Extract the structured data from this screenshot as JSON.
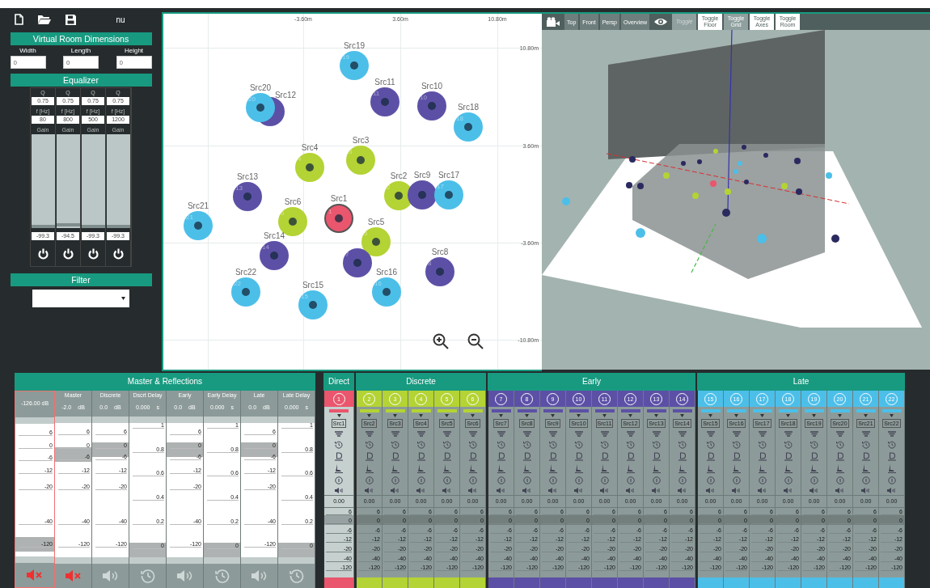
{
  "toolbar": {
    "label": "nu"
  },
  "room": {
    "title": "Virtual Room Dimensions",
    "fields": [
      {
        "label": "Width",
        "value": "0"
      },
      {
        "label": "Length",
        "value": "0"
      },
      {
        "label": "Height",
        "value": "0"
      }
    ]
  },
  "equalizer": {
    "title": "Equalizer",
    "bands": [
      {
        "q_label": "Q",
        "q": "0.75",
        "f_label": "f [Hz]",
        "f": "80",
        "gain_label": "Gain",
        "gain": "-99.3",
        "level": 0,
        "on": true
      },
      {
        "q_label": "Q",
        "q": "0.75",
        "f_label": "f [Hz]",
        "f": "800",
        "gain_label": "Gain",
        "gain": "-94.5",
        "level": 0.02,
        "on": true
      },
      {
        "q_label": "Q",
        "q": "0.75",
        "f_label": "f [Hz]",
        "f": "500",
        "gain_label": "Gain",
        "gain": "-99.3",
        "level": 0,
        "on": true
      },
      {
        "q_label": "Q",
        "q": "0.75",
        "f_label": "f [Hz]",
        "f": "1200",
        "gain_label": "Gain",
        "gain": "-99.3",
        "level": 0,
        "on": true
      }
    ]
  },
  "filter": {
    "title": "Filter"
  },
  "map": {
    "x_ticks": [
      "-3.60m",
      "3.60m",
      "10.80m"
    ],
    "y_ticks": [
      "10.80m",
      "3.60m",
      "-3.60m",
      "-10.80m"
    ],
    "sources": [
      {
        "label": "Src19",
        "number": "19",
        "color": "#4cbfe9",
        "selected": false
      },
      {
        "label": "Src20",
        "number": "20",
        "color": "#4cbfe9",
        "selected": false
      },
      {
        "label": "Src12",
        "color": "#5c50a6",
        "selected": false
      },
      {
        "label": "Src11",
        "number": "11",
        "color": "#5c50a6",
        "selected": false
      },
      {
        "label": "Src10",
        "number": "10",
        "color": "#5c50a6",
        "selected": false
      },
      {
        "label": "Src18",
        "number": "18",
        "color": "#4cbfe9",
        "selected": false
      },
      {
        "label": "Src4",
        "number": "4",
        "color": "#b4d334",
        "selected": false
      },
      {
        "label": "Src3",
        "number": "3",
        "color": "#b4d334",
        "selected": false
      },
      {
        "label": "Src13",
        "number": "13",
        "color": "#5c50a6",
        "selected": false
      },
      {
        "label": "Src2",
        "number": "2",
        "color": "#b4d334",
        "selected": false
      },
      {
        "label": "Src9",
        "color": "#5c50a6",
        "selected": false
      },
      {
        "label": "Src17",
        "number": "17",
        "color": "#4cbfe9",
        "selected": false
      },
      {
        "label": "Src21",
        "number": "21",
        "color": "#4cbfe9",
        "selected": false
      },
      {
        "label": "Src6",
        "number": "6",
        "color": "#b4d334",
        "selected": false
      },
      {
        "label": "Src1",
        "number": "1",
        "color": "#e9566d",
        "selected": true
      },
      {
        "label": "Src14",
        "number": "14",
        "color": "#5c50a6",
        "selected": false
      },
      {
        "label": "Src5",
        "number": "5",
        "color": "#b4d334",
        "selected": false
      },
      {
        "number": "7",
        "color": "#5c50a6",
        "selected": false
      },
      {
        "label": "Src8",
        "number": "8",
        "color": "#5c50a6",
        "selected": false
      },
      {
        "label": "Src22",
        "number": "22",
        "color": "#4cbfe9",
        "selected": false
      },
      {
        "label": "Src15",
        "number": "15",
        "color": "#4cbfe9",
        "selected": false
      },
      {
        "label": "Src16",
        "number": "16",
        "color": "#4cbfe9",
        "selected": false
      }
    ]
  },
  "view3d": {
    "views": [
      "Top",
      "Front",
      "Persp",
      "Overview"
    ],
    "toggles": [
      {
        "label": "Toggle",
        "on": false,
        "disabled": true
      },
      {
        "label": "Toggle Floor",
        "on": true,
        "disabled": false
      },
      {
        "label": "Toggle Grid",
        "on": false,
        "disabled": false
      },
      {
        "label": "Toggle Axes",
        "on": true,
        "disabled": false
      },
      {
        "label": "Toggle Room",
        "on": true,
        "disabled": false
      }
    ]
  },
  "master": {
    "title": "Master & Reflections",
    "meter": {
      "reading": "-126.00 dB",
      "level": 0.04,
      "muted": true,
      "scale": [
        "6",
        "0",
        "-6",
        "-12",
        "-20",
        "-40",
        "-120"
      ]
    },
    "strips": [
      {
        "label": "Master",
        "value": "-2.0",
        "unit": "dB",
        "kind": "gain",
        "level": 0.8,
        "muted": true,
        "scale": [
          "6",
          "0",
          "-6",
          "-12",
          "-20",
          "-40",
          "-120"
        ]
      },
      {
        "label": "Discrete",
        "value": "0.0",
        "unit": "dB",
        "kind": "gain",
        "level": 0.84,
        "muted": false,
        "scale": [
          "6",
          "0",
          "-6",
          "-12",
          "-20",
          "-40",
          "-120"
        ]
      },
      {
        "label": "Dscrt Delay",
        "value": "0.000",
        "unit": "s",
        "kind": "delay",
        "level": 0,
        "scale": [
          "1",
          "0.8",
          "0.6",
          "0.4",
          "0.2",
          "0"
        ]
      },
      {
        "label": "Early",
        "value": "0.0",
        "unit": "dB",
        "kind": "gain",
        "level": 0.84,
        "muted": false,
        "scale": [
          "6",
          "0",
          "-6",
          "-12",
          "-20",
          "-40",
          "-120"
        ]
      },
      {
        "label": "Early Delay",
        "value": "0.000",
        "unit": "s",
        "kind": "delay",
        "level": 0,
        "scale": [
          "1",
          "0.8",
          "0.6",
          "0.4",
          "0.2",
          "0"
        ]
      },
      {
        "label": "Late",
        "value": "0.0",
        "unit": "dB",
        "kind": "gain",
        "level": 0.84,
        "muted": false,
        "scale": [
          "6",
          "0",
          "-6",
          "-12",
          "-20",
          "-40",
          "-120"
        ]
      },
      {
        "label": "Late Delay",
        "value": "0.000",
        "unit": "s",
        "kind": "delay",
        "level": 0,
        "scale": [
          "1",
          "0.8",
          "0.6",
          "0.4",
          "0.2",
          "0"
        ]
      }
    ]
  },
  "groups": [
    {
      "title": "Direct",
      "color": "#e9566d",
      "channels": [
        {
          "number": "1",
          "source": "Src1",
          "value": "0.00",
          "selected": true,
          "level": 0.85,
          "scale": [
            "6",
            "0",
            "-6",
            "-12",
            "-20",
            "-40",
            "-120"
          ]
        }
      ]
    },
    {
      "title": "Discrete",
      "color": "#b4d334",
      "channels": [
        {
          "number": "2",
          "source": "Src2",
          "value": "0.00",
          "selected": false,
          "level": 0.85,
          "scale": [
            "6",
            "0",
            "-6",
            "-12",
            "-20",
            "-40",
            "-120"
          ]
        },
        {
          "number": "3",
          "source": "Src3",
          "value": "0.00",
          "selected": false,
          "level": 0.85,
          "scale": [
            "6",
            "0",
            "-6",
            "-12",
            "-20",
            "-40",
            "-120"
          ]
        },
        {
          "number": "4",
          "source": "Src4",
          "value": "0.00",
          "selected": false,
          "level": 0.85,
          "scale": [
            "6",
            "0",
            "-6",
            "-12",
            "-20",
            "-40",
            "-120"
          ]
        },
        {
          "number": "5",
          "source": "Src5",
          "value": "0.00",
          "selected": false,
          "level": 0.85,
          "scale": [
            "6",
            "0",
            "-6",
            "-12",
            "-20",
            "-40",
            "-120"
          ]
        },
        {
          "number": "6",
          "source": "Src6",
          "value": "0.00",
          "selected": false,
          "level": 0.85,
          "scale": [
            "6",
            "0",
            "-6",
            "-12",
            "-20",
            "-40",
            "-120"
          ]
        }
      ]
    },
    {
      "title": "Early",
      "color": "#5c50a6",
      "channels": [
        {
          "number": "7",
          "source": "Src7",
          "value": "0.00",
          "selected": false,
          "level": 0.85,
          "scale": [
            "6",
            "0",
            "-6",
            "-12",
            "-20",
            "-40",
            "-120"
          ]
        },
        {
          "number": "8",
          "source": "Src8",
          "value": "0.00",
          "selected": false,
          "level": 0.85,
          "scale": [
            "6",
            "0",
            "-6",
            "-12",
            "-20",
            "-40",
            "-120"
          ]
        },
        {
          "number": "9",
          "source": "Src9",
          "value": "0.00",
          "selected": false,
          "level": 0.85,
          "scale": [
            "6",
            "0",
            "-6",
            "-12",
            "-20",
            "-40",
            "-120"
          ]
        },
        {
          "number": "10",
          "source": "Src10",
          "value": "0.00",
          "selected": false,
          "level": 0.85,
          "scale": [
            "6",
            "0",
            "-6",
            "-12",
            "-20",
            "-40",
            "-120"
          ]
        },
        {
          "number": "11",
          "source": "Src11",
          "value": "0.00",
          "selected": false,
          "level": 0.85,
          "scale": [
            "6",
            "0",
            "-6",
            "-12",
            "-20",
            "-40",
            "-120"
          ]
        },
        {
          "number": "12",
          "source": "Src12",
          "value": "0.00",
          "selected": false,
          "level": 0.85,
          "scale": [
            "6",
            "0",
            "-6",
            "-12",
            "-20",
            "-40",
            "-120"
          ]
        },
        {
          "number": "13",
          "source": "Src13",
          "value": "0.00",
          "selected": false,
          "level": 0.85,
          "scale": [
            "6",
            "0",
            "-6",
            "-12",
            "-20",
            "-40",
            "-120"
          ]
        },
        {
          "number": "14",
          "source": "Src14",
          "value": "0.00",
          "selected": false,
          "level": 0.85,
          "scale": [
            "6",
            "0",
            "-6",
            "-12",
            "-20",
            "-40",
            "-120"
          ]
        }
      ]
    },
    {
      "title": "Late",
      "color": "#4cbfe9",
      "channels": [
        {
          "number": "15",
          "source": "Src15",
          "value": "0.00",
          "selected": false,
          "level": 0.85,
          "scale": [
            "6",
            "0",
            "-6",
            "-12",
            "-20",
            "-40",
            "-120"
          ]
        },
        {
          "number": "16",
          "source": "Src16",
          "value": "0.00",
          "selected": false,
          "level": 0.85,
          "scale": [
            "6",
            "0",
            "-6",
            "-12",
            "-20",
            "-40",
            "-120"
          ]
        },
        {
          "number": "17",
          "source": "Src17",
          "value": "0.00",
          "selected": false,
          "level": 0.85,
          "scale": [
            "6",
            "0",
            "-6",
            "-12",
            "-20",
            "-40",
            "-120"
          ]
        },
        {
          "number": "18",
          "source": "Src18",
          "value": "0.00",
          "selected": false,
          "level": 0.85,
          "scale": [
            "6",
            "0",
            "-6",
            "-12",
            "-20",
            "-40",
            "-120"
          ]
        },
        {
          "number": "19",
          "source": "Src19",
          "value": "0.00",
          "selected": false,
          "level": 0.85,
          "scale": [
            "6",
            "0",
            "-6",
            "-12",
            "-20",
            "-40",
            "-120"
          ]
        },
        {
          "number": "20",
          "source": "Src20",
          "value": "0.00",
          "selected": false,
          "level": 0.85,
          "scale": [
            "6",
            "0",
            "-6",
            "-12",
            "-20",
            "-40",
            "-120"
          ]
        },
        {
          "number": "21",
          "source": "Src21",
          "value": "0.00",
          "selected": false,
          "level": 0.85,
          "scale": [
            "6",
            "0",
            "-6",
            "-12",
            "-20",
            "-40",
            "-120"
          ]
        },
        {
          "number": "22",
          "source": "Src22",
          "value": "0.00",
          "selected": false,
          "level": 0.85,
          "scale": [
            "6",
            "0",
            "-6",
            "-12",
            "-20",
            "-40",
            "-120"
          ]
        }
      ]
    }
  ]
}
